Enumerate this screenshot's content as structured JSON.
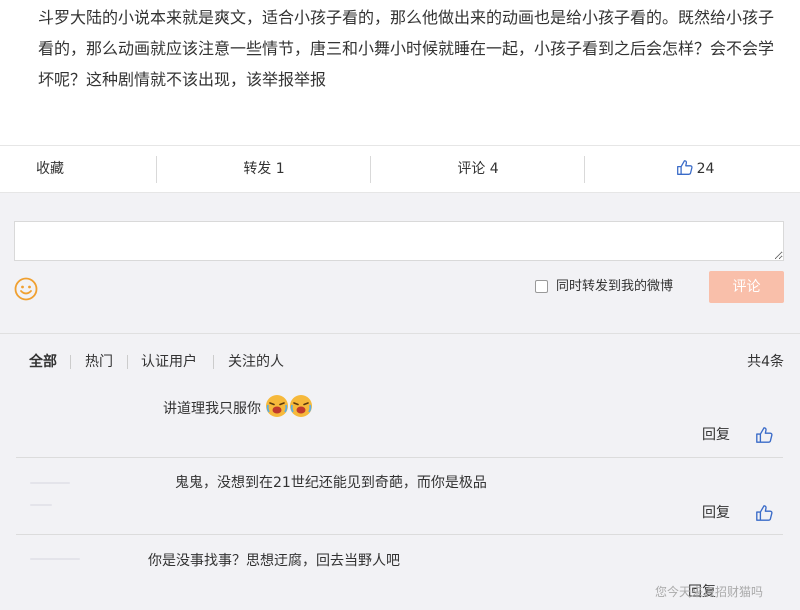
{
  "post": {
    "text": "斗罗大陆的小说本来就是爽文，适合小孩子看的，那么他做出来的动画也是给小孩子看的。既然给小孩子看的，那么动画就应该注意一些情节，唐三和小舞小时候就睡在一起，小孩子看到之后会怎样？会不会学坏呢？这种剧情就不该出现，该举报举报"
  },
  "actions": {
    "favorite": "收藏",
    "repost": "转发 1",
    "comment": "评论 4",
    "like_count": "24"
  },
  "compose": {
    "input_value": "",
    "repost_label": "同时转发到我的微博",
    "submit": "评论"
  },
  "filters": {
    "tabs": [
      "全部",
      "热门",
      "认证用户",
      "关注的人"
    ],
    "total": "共4条"
  },
  "comments": [
    {
      "text": "讲道理我只服你",
      "reply": "回复"
    },
    {
      "text": "鬼鬼，没想到在21世纪还能见到奇葩，而你是极品",
      "reply": "回复"
    },
    {
      "text": "你是没事找事？思想迂腐，回去当野人吧",
      "reply": "回复"
    }
  ],
  "watermark": "您今天来点招财猫吗",
  "colors": {
    "accent": "#f9bfaa",
    "like_blue": "#3a6bc8",
    "emoji_orange": "#f0a030",
    "background": "#f2f2f5"
  }
}
